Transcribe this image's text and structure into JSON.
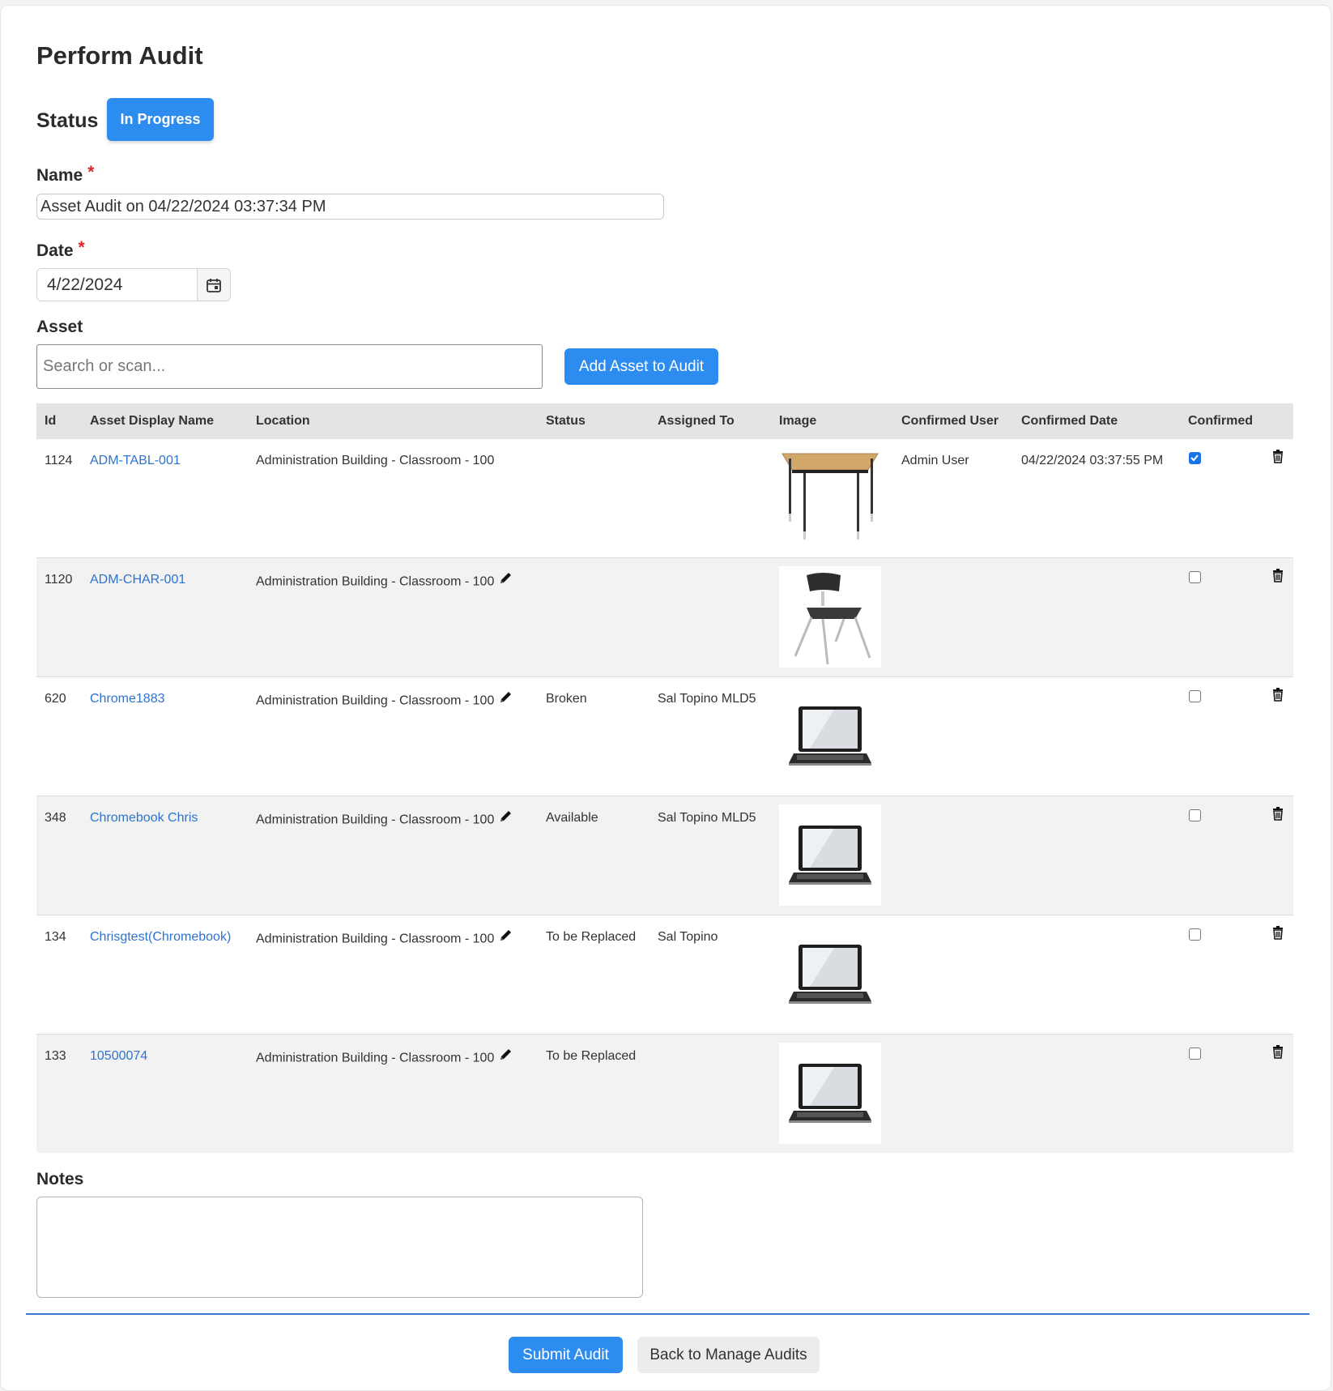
{
  "page": {
    "title": "Perform Audit"
  },
  "status": {
    "label": "Status",
    "value": "In Progress"
  },
  "form": {
    "name_label": "Name",
    "name_value": "Asset Audit on 04/22/2024 03:37:34 PM",
    "date_label": "Date",
    "date_value": "4/22/2024",
    "asset_label": "Asset",
    "asset_placeholder": "Search or scan...",
    "add_button": "Add Asset to Audit",
    "required_mark": "*"
  },
  "table": {
    "columns": [
      "Id",
      "Asset Display Name",
      "Location",
      "Status",
      "Assigned To",
      "Image",
      "Confirmed User",
      "Confirmed Date",
      "Confirmed"
    ],
    "rows": [
      {
        "id": "1124",
        "name": "ADM-TABL-001",
        "location": "Administration Building - Classroom - 100",
        "status": "",
        "assigned_to": "",
        "image": "table-icon",
        "confirmed_user": "Admin User",
        "confirmed_date": "04/22/2024 03:37:55 PM",
        "confirmed": true
      },
      {
        "id": "1120",
        "name": "ADM-CHAR-001",
        "location": "Administration Building - Classroom - 100",
        "status": "",
        "assigned_to": "",
        "image": "chair-icon",
        "confirmed_user": "",
        "confirmed_date": "",
        "confirmed": false
      },
      {
        "id": "620",
        "name": "Chrome1883",
        "location": "Administration Building - Classroom - 100",
        "status": "Broken",
        "assigned_to": "Sal Topino MLD5",
        "image": "laptop-icon",
        "confirmed_user": "",
        "confirmed_date": "",
        "confirmed": false
      },
      {
        "id": "348",
        "name": "Chromebook Chris",
        "location": "Administration Building - Classroom - 100",
        "status": "Available",
        "assigned_to": "Sal Topino MLD5",
        "image": "laptop-icon",
        "confirmed_user": "",
        "confirmed_date": "",
        "confirmed": false
      },
      {
        "id": "134",
        "name": "Chrisgtest(Chromebook)",
        "location": "Administration Building - Classroom - 100",
        "status": "To be Replaced",
        "assigned_to": "Sal Topino",
        "image": "laptop-icon",
        "confirmed_user": "",
        "confirmed_date": "",
        "confirmed": false
      },
      {
        "id": "133",
        "name": "10500074",
        "location": "Administration Building - Classroom - 100",
        "status": "To be Replaced",
        "assigned_to": "",
        "image": "laptop-icon",
        "confirmed_user": "",
        "confirmed_date": "",
        "confirmed": false
      }
    ]
  },
  "notes": {
    "label": "Notes",
    "value": ""
  },
  "actions": {
    "submit": "Submit Audit",
    "back": "Back to Manage Audits"
  },
  "colors": {
    "primary": "#2d8cf0",
    "link": "#2d73d2",
    "required": "#e02424",
    "divider": "#3a78c8"
  }
}
